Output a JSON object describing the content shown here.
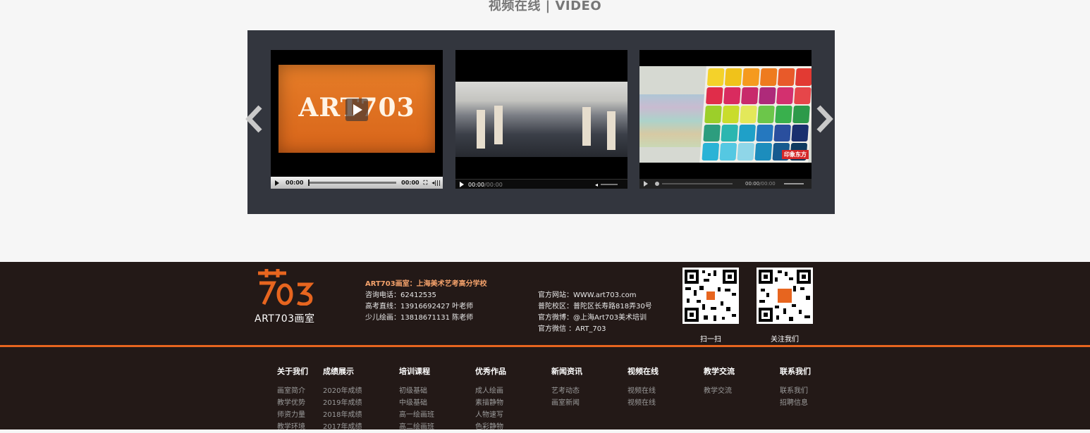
{
  "section": {
    "title": "视频在线 | VIDEO"
  },
  "videos": [
    {
      "logo_text": "ART703",
      "time_current": "00:00",
      "time_total": "00:00"
    },
    {
      "time_current": "00:00",
      "time_total": "/00:00"
    },
    {
      "overlay_brand": "印象东方",
      "time_current": "00:00",
      "time_total": "/00:00"
    }
  ],
  "footer": {
    "brand_name": "ART703画室",
    "school_title": "ART703画室：上海美术艺考高分学校",
    "phone_line": "咨询电话：62412535",
    "gaokao_line": "高考直线：13916692427 叶老师",
    "kids_line": "少儿绘画：13818671131 陈老师",
    "website_line": "官方网站：WWW.art703.com",
    "campus_line": "普陀校区：普陀区长寿路818弄30号",
    "weibo_line": "官方微博：@上海Art703美术培训",
    "wechat_line": "官方微信 ：ART_703",
    "qr1_label": "扫一扫",
    "qr2_label": "关注我们"
  },
  "nav": [
    {
      "head": "关于我们",
      "links": [
        "画室简介",
        "教学优势",
        "师资力量",
        "教学环境"
      ]
    },
    {
      "head": "成绩展示",
      "links": [
        "2020年成绩",
        "2019年成绩",
        "2018年成绩",
        "2017年成绩"
      ]
    },
    {
      "head": "培训课程",
      "links": [
        "初级基础",
        "中级基础",
        "高一绘画班",
        "高二绘画班"
      ]
    },
    {
      "head": "优秀作品",
      "links": [
        "成人绘画",
        "素描静物",
        "人物速写",
        "色彩静物"
      ]
    },
    {
      "head": "新闻资讯",
      "links": [
        "艺考动态",
        "画室新闻"
      ]
    },
    {
      "head": "视频在线",
      "links": [
        "视频在线",
        "视频在线"
      ]
    },
    {
      "head": "教学交流",
      "links": [
        "教学交流"
      ]
    },
    {
      "head": "联系我们",
      "links": [
        "联系我们",
        "招聘信息"
      ]
    }
  ],
  "colors": {
    "accent": "#e7651f",
    "footer_bg": "#231917",
    "panel_bg": "#33363e"
  }
}
